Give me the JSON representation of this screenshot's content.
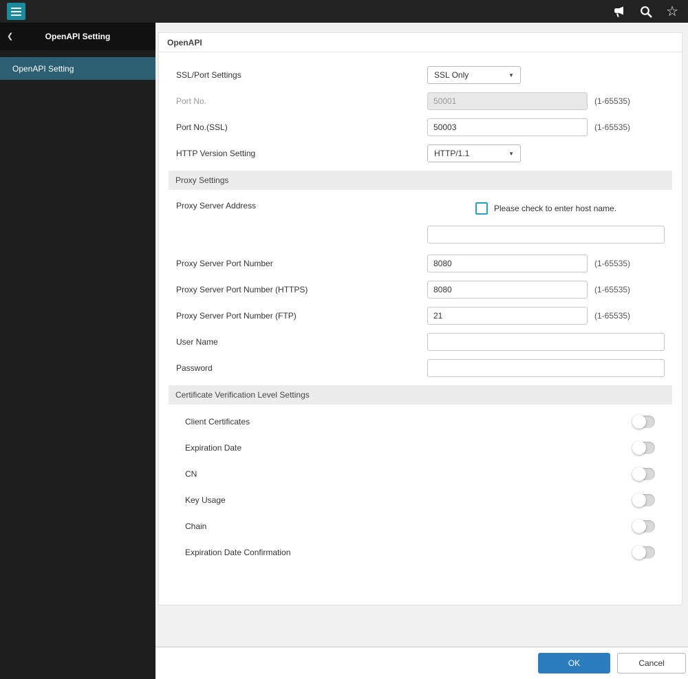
{
  "icons": {
    "back": "❮",
    "star": "☆",
    "select_caret": "▼"
  },
  "colors": {
    "topbar_bg": "#222222",
    "accent_teal": "#1b8a9e",
    "nav_selected": "#2d5f73",
    "ok_button": "#2b7dbd",
    "checkbox_accent": "#25a0c5"
  },
  "sidebar": {
    "header_title": "OpenAPI Setting",
    "items": [
      {
        "label": "OpenAPI Setting",
        "selected": true
      }
    ]
  },
  "panel": {
    "title": "OpenAPI"
  },
  "form": {
    "ssl_port": {
      "label": "SSL/Port Settings",
      "value": "SSL Only"
    },
    "port_no": {
      "label": "Port No.",
      "value": "50001",
      "hint": "(1-65535)",
      "disabled": true
    },
    "port_ssl": {
      "label": "Port No.(SSL)",
      "value": "50003",
      "hint": "(1-65535)"
    },
    "http_version": {
      "label": "HTTP Version Setting",
      "value": "HTTP/1.1"
    },
    "proxy_section_title": "Proxy Settings",
    "proxy_address": {
      "label": "Proxy Server Address",
      "checkbox_label": "Please check to enter host name.",
      "checkbox_checked": false,
      "value": ""
    },
    "proxy_port": {
      "label": "Proxy Server Port Number",
      "value": "8080",
      "hint": "(1-65535)"
    },
    "proxy_port_https": {
      "label": "Proxy Server Port Number (HTTPS)",
      "value": "8080",
      "hint": "(1-65535)"
    },
    "proxy_port_ftp": {
      "label": "Proxy Server Port Number (FTP)",
      "value": "21",
      "hint": "(1-65535)"
    },
    "user_name": {
      "label": "User Name",
      "value": ""
    },
    "password": {
      "label": "Password",
      "value": ""
    },
    "cert_section_title": "Certificate Verification Level Settings",
    "toggles": [
      {
        "label": "Client Certificates",
        "state": "off"
      },
      {
        "label": "Expiration Date",
        "state": "off"
      },
      {
        "label": "CN",
        "state": "off"
      },
      {
        "label": "Key Usage",
        "state": "off"
      },
      {
        "label": "Chain",
        "state": "off"
      },
      {
        "label": "Expiration Date Confirmation",
        "state": "off"
      }
    ]
  },
  "footer": {
    "ok_label": "OK",
    "cancel_label": "Cancel"
  }
}
